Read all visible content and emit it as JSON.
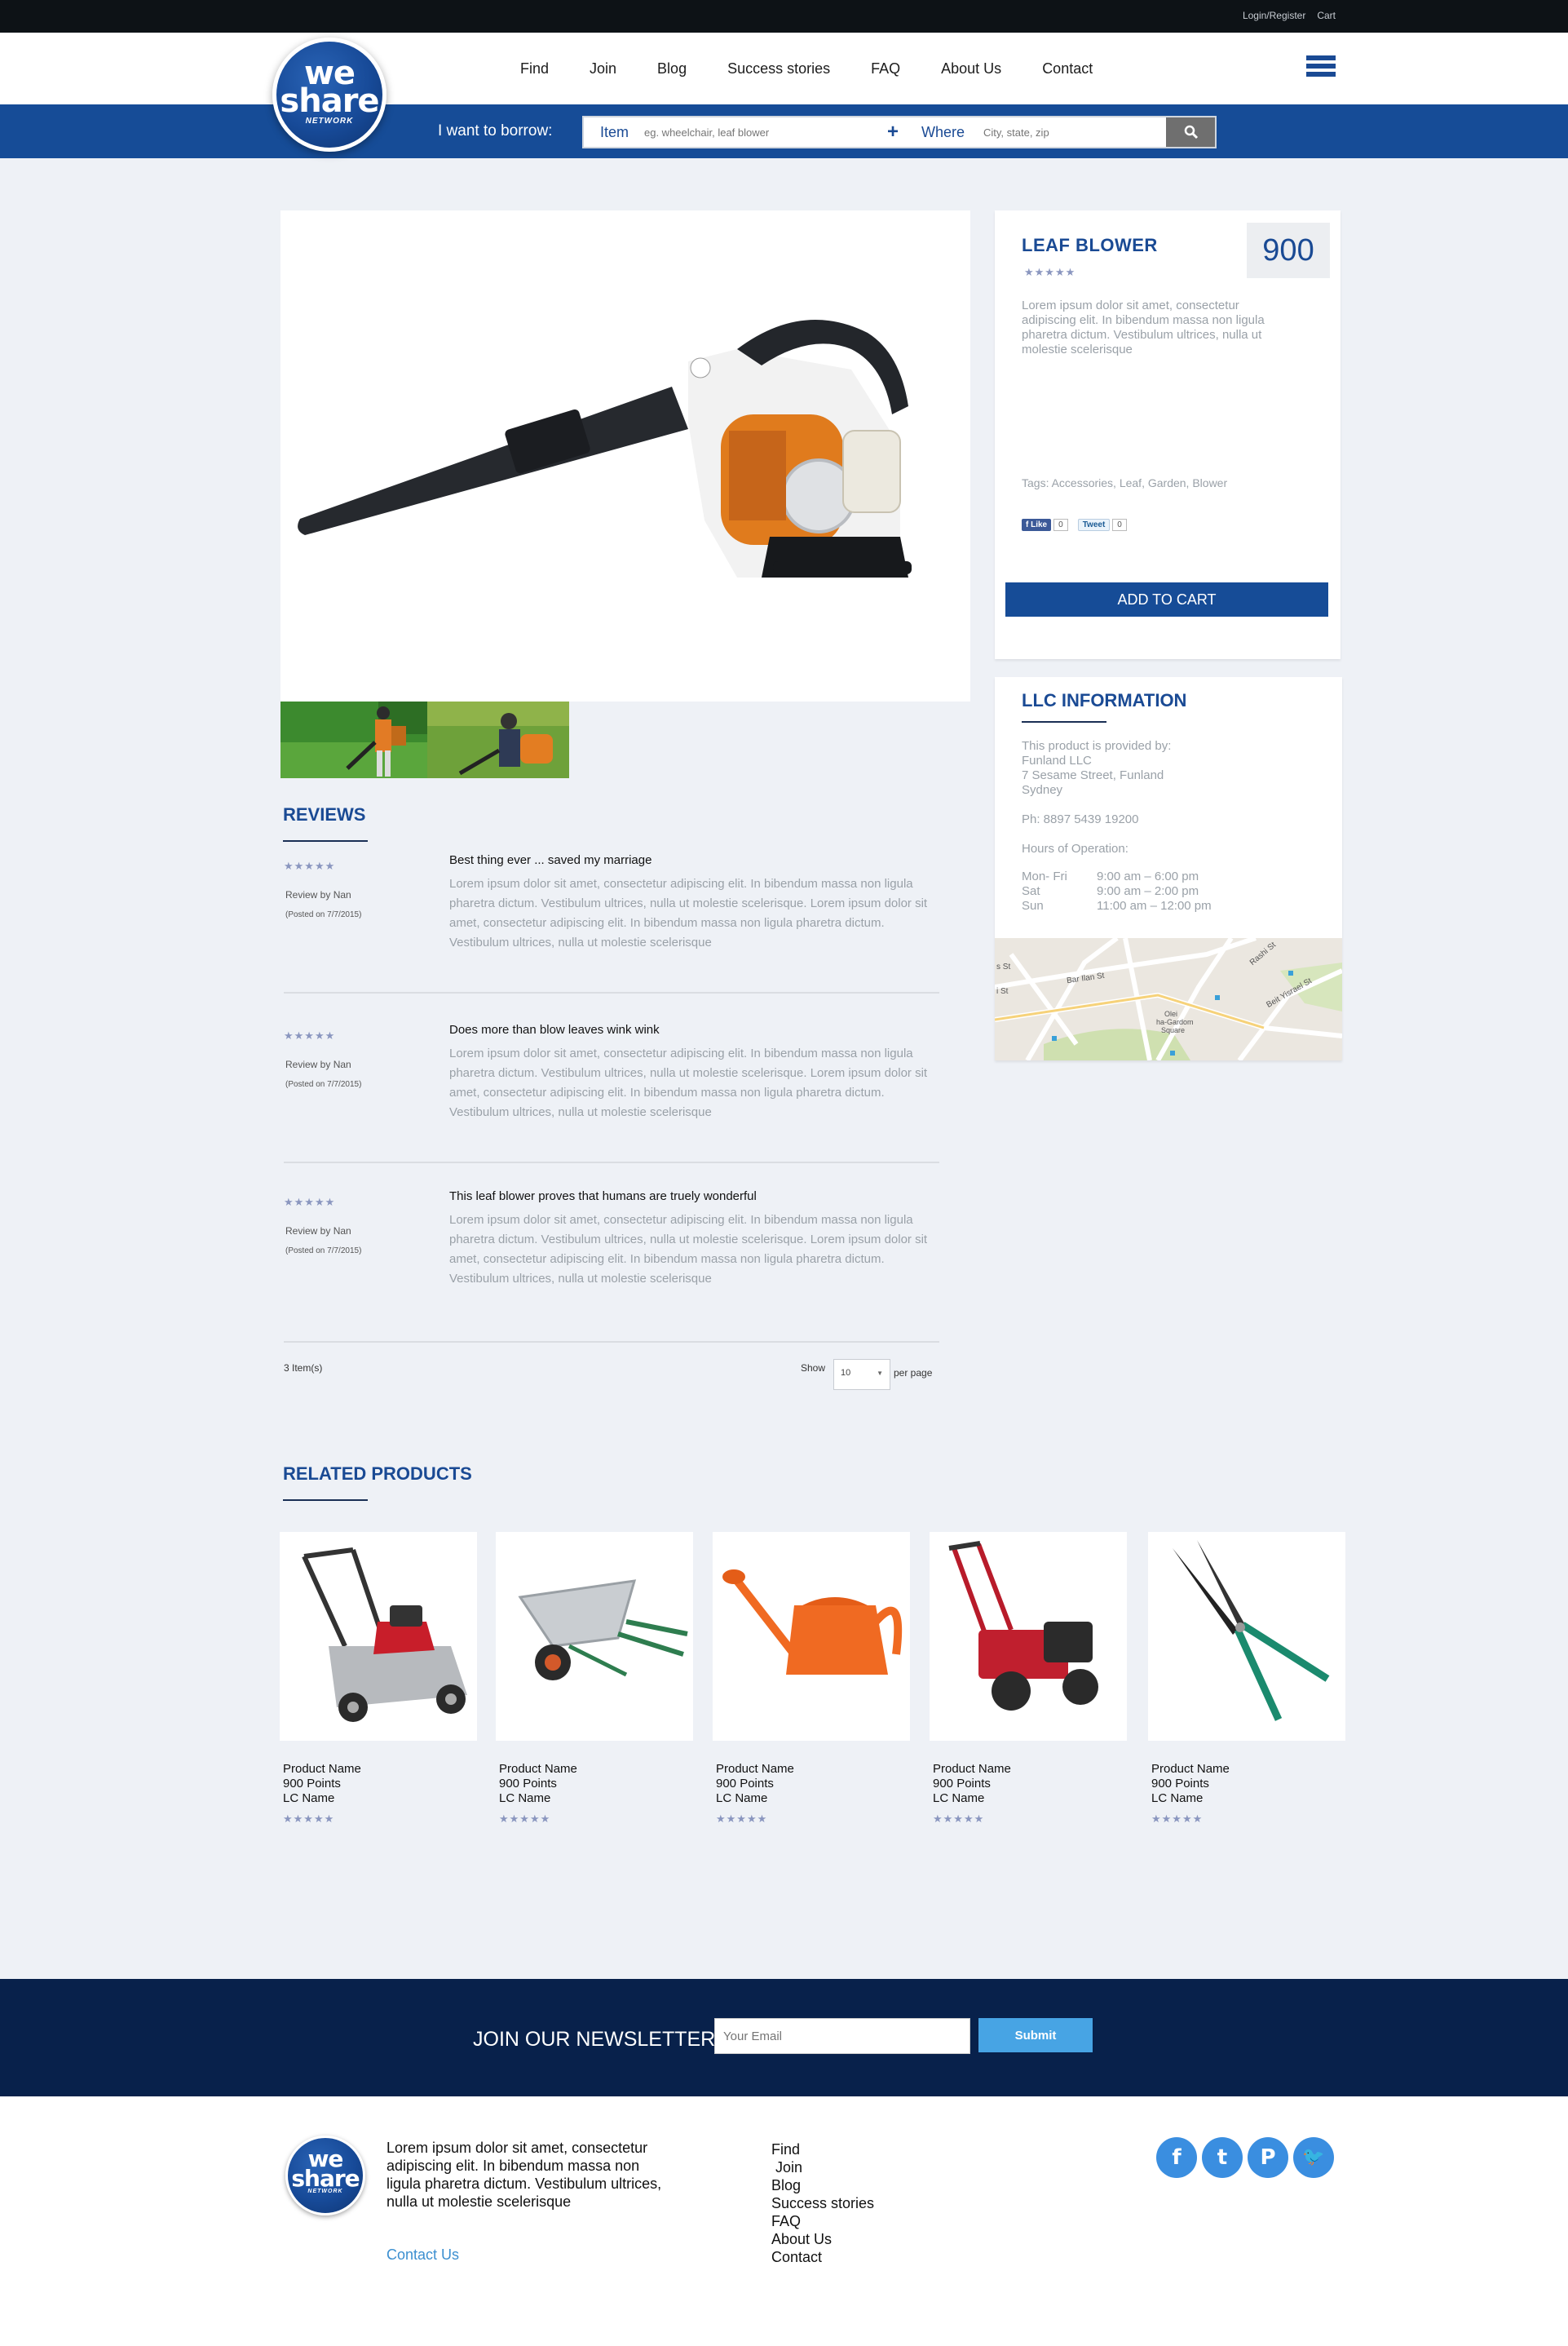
{
  "topbar": {
    "login": "Login/Register",
    "cart": "Cart"
  },
  "brand": {
    "we": "we",
    "share": "share",
    "network": "NETWORK"
  },
  "nav": [
    "Find",
    "Join",
    "Blog",
    "Success stories",
    "FAQ",
    "About Us",
    "Contact"
  ],
  "search": {
    "label": "I want to borrow:",
    "item_label": "Item",
    "item_placeholder": "eg. wheelchair, leaf blower",
    "where_label": "Where",
    "where_placeholder": "City, state, zip"
  },
  "product": {
    "title": "LEAF BLOWER",
    "price": "900",
    "rating": "★★★★★",
    "description": "Lorem ipsum dolor sit amet, consectetur adipiscing elit. In bibendum massa non ligula pharetra dictum. Vestibulum ultrices, nulla ut molestie scelerisque",
    "tags": "Tags: Accessories, Leaf, Garden, Blower",
    "like_label": "Like",
    "like_count": "0",
    "tweet_label": "Tweet",
    "tweet_count": "0",
    "add_to_cart": "ADD TO CART"
  },
  "llc": {
    "title": "LLC INFORMATION",
    "provided_by": "This product is provided by:",
    "name": "Funland LLC",
    "street": "7 Sesame Street, Funland",
    "city": "Sydney",
    "phone": "Ph: 8897 5439 19200",
    "hours_title": "Hours of Operation:",
    "hours": [
      {
        "day": "Mon- Fri",
        "time": "9:00 am – 6:00 pm"
      },
      {
        "day": "Sat",
        "time": "9:00 am – 2:00 pm"
      },
      {
        "day": "Sun",
        "time": "11:00 am – 12:00 pm"
      }
    ],
    "map_labels": [
      "Bar Ilan St",
      "Rashi St",
      "Beit Yisrael St",
      "Olei",
      "ha-Gardom",
      "Square",
      "i St",
      "s St"
    ]
  },
  "reviews": {
    "title": "REVIEWS",
    "items": [
      {
        "stars": "★★★★★",
        "by": "Review by Nan",
        "posted": "(Posted on 7/7/2015)",
        "title": "Best thing ever ... saved my marriage",
        "body": "Lorem ipsum dolor sit amet, consectetur adipiscing elit. In bibendum massa non ligula pharetra dictum. Vestibulum ultrices, nulla ut molestie scelerisque. Lorem ipsum dolor sit amet, consectetur adipiscing elit. In bibendum massa non ligula pharetra dictum. Vestibulum ultrices, nulla ut molestie scelerisque"
      },
      {
        "stars": "★★★★★",
        "by": "Review by Nan",
        "posted": "(Posted on 7/7/2015)",
        "title": "Does more than blow leaves wink wink",
        "body": "Lorem ipsum dolor sit amet, consectetur adipiscing elit. In bibendum massa non ligula pharetra dictum. Vestibulum ultrices, nulla ut molestie scelerisque. Lorem ipsum dolor sit amet, consectetur adipiscing elit. In bibendum massa non ligula pharetra dictum. Vestibulum ultrices, nulla ut molestie scelerisque"
      },
      {
        "stars": "★★★★★",
        "by": "Review by Nan",
        "posted": "(Posted on 7/7/2015)",
        "title": "This leaf blower proves that humans are truely wonderful",
        "body": "Lorem ipsum dolor sit amet, consectetur adipiscing elit. In bibendum massa non ligula pharetra dictum. Vestibulum ultrices, nulla ut molestie scelerisque. Lorem ipsum dolor sit amet, consectetur adipiscing elit. In bibendum massa non ligula pharetra dictum. Vestibulum ultrices, nulla ut molestie scelerisque"
      }
    ],
    "count": "3 Item(s)",
    "show_label": "Show",
    "show_value": "10",
    "per_page": "per page"
  },
  "related": {
    "title": "RELATED PRODUCTS",
    "items": [
      {
        "icon": "lawn-mower-icon",
        "name": "Product Name",
        "points": "900 Points",
        "llc": "LC Name",
        "stars": "★★★★★"
      },
      {
        "icon": "wheelbarrow-icon",
        "name": "Product Name",
        "points": "900 Points",
        "llc": "LC Name",
        "stars": "★★★★★"
      },
      {
        "icon": "watering-can-icon",
        "name": "Product Name",
        "points": "900 Points",
        "llc": "LC Name",
        "stars": "★★★★★"
      },
      {
        "icon": "tiller-icon",
        "name": "Product Name",
        "points": "900 Points",
        "llc": "LC Name",
        "stars": "★★★★★"
      },
      {
        "icon": "hedge-shears-icon",
        "name": "Product Name",
        "points": "900 Points",
        "llc": "LC Name",
        "stars": "★★★★★"
      }
    ]
  },
  "newsletter": {
    "label": "JOIN OUR NEWSLETTER",
    "placeholder": "Your Email",
    "submit": "Submit"
  },
  "footer": {
    "description": "Lorem ipsum dolor sit amet, consectetur adipiscing elit. In bibendum massa non ligula pharetra dictum. Vestibulum ultrices, nulla ut molestie scelerisque",
    "contact": "Contact Us",
    "nav": [
      "Find",
      " Join",
      "Blog",
      "Success stories",
      "FAQ",
      "About Us",
      "Contact"
    ],
    "social": [
      {
        "icon": "facebook-icon",
        "glyph": "f"
      },
      {
        "icon": "tumblr-icon",
        "glyph": "t"
      },
      {
        "icon": "pinterest-icon",
        "glyph": "P"
      },
      {
        "icon": "twitter-icon",
        "glyph": "🐦"
      }
    ]
  },
  "colors": {
    "brand_blue": "#164c97",
    "dark_navy": "#08214b",
    "accent_light_blue": "#47a4e4",
    "star": "#8a96bf"
  }
}
